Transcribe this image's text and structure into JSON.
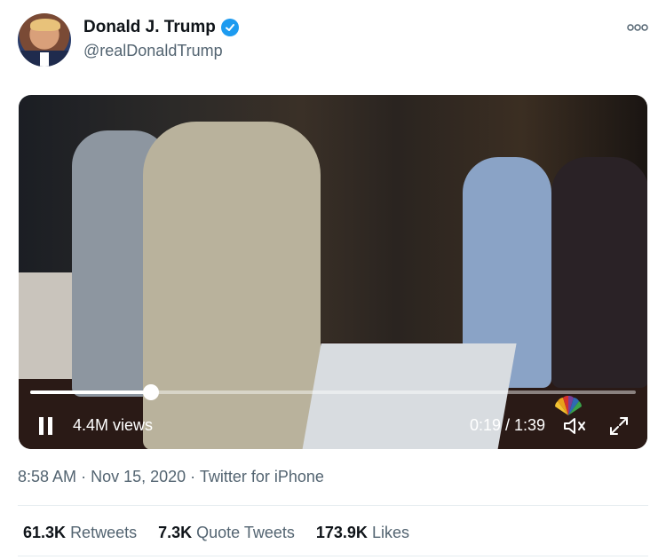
{
  "author": {
    "name": "Donald J. Trump",
    "handle": "@realDonaldTrump",
    "verified": true
  },
  "video": {
    "views": "4.4M views",
    "time": "0:19 / 1:39",
    "progress": 0.2,
    "state": "playing",
    "watermark": "NBC"
  },
  "meta": {
    "time": "8:58 AM",
    "sep1": "·",
    "date": "Nov 15, 2020",
    "sep2": "·",
    "source": "Twitter for iPhone"
  },
  "stats": {
    "retweets_count": "61.3K",
    "retweets_label": "Retweets",
    "quotes_count": "7.3K",
    "quotes_label": "Quote Tweets",
    "likes_count": "173.9K",
    "likes_label": "Likes"
  },
  "colors": {
    "verified": "#1d9bf0",
    "secondary_text": "#536471"
  },
  "icons": [
    "verified-badge-icon",
    "more-options-icon",
    "pause-icon",
    "mute-icon",
    "fullscreen-icon",
    "nbc-peacock-logo"
  ]
}
